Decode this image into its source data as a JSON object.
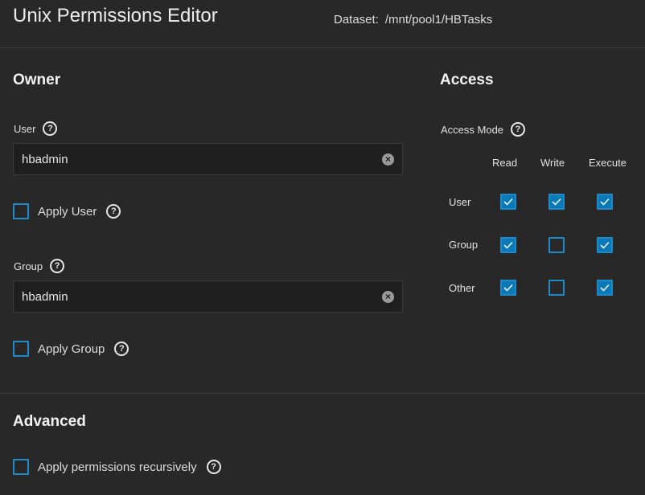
{
  "header": {
    "title": "Unix Permissions Editor",
    "dataset_label": "Dataset:",
    "dataset_path": "/mnt/pool1/HBTasks"
  },
  "owner": {
    "section_title": "Owner",
    "user_label": "User",
    "user_value": "hbadmin",
    "apply_user_label": "Apply User",
    "apply_user_checked": false,
    "group_label": "Group",
    "group_value": "hbadmin",
    "apply_group_label": "Apply Group",
    "apply_group_checked": false
  },
  "access": {
    "section_title": "Access",
    "mode_label": "Access Mode",
    "columns": [
      "Read",
      "Write",
      "Execute"
    ],
    "rows": [
      {
        "label": "User",
        "read": true,
        "write": true,
        "execute": true
      },
      {
        "label": "Group",
        "read": true,
        "write": false,
        "execute": true
      },
      {
        "label": "Other",
        "read": true,
        "write": false,
        "execute": true
      }
    ]
  },
  "advanced": {
    "section_title": "Advanced",
    "recursive_label": "Apply permissions recursively",
    "recursive_checked": false
  },
  "icons": {
    "help": "help-circle-icon",
    "clear": "clear-circle-icon",
    "check": "check-icon"
  },
  "colors": {
    "background": "#282828",
    "input_bg": "#1f1f1f",
    "accent": "#0b78b8",
    "checkbox_border": "#1e8ac9"
  }
}
